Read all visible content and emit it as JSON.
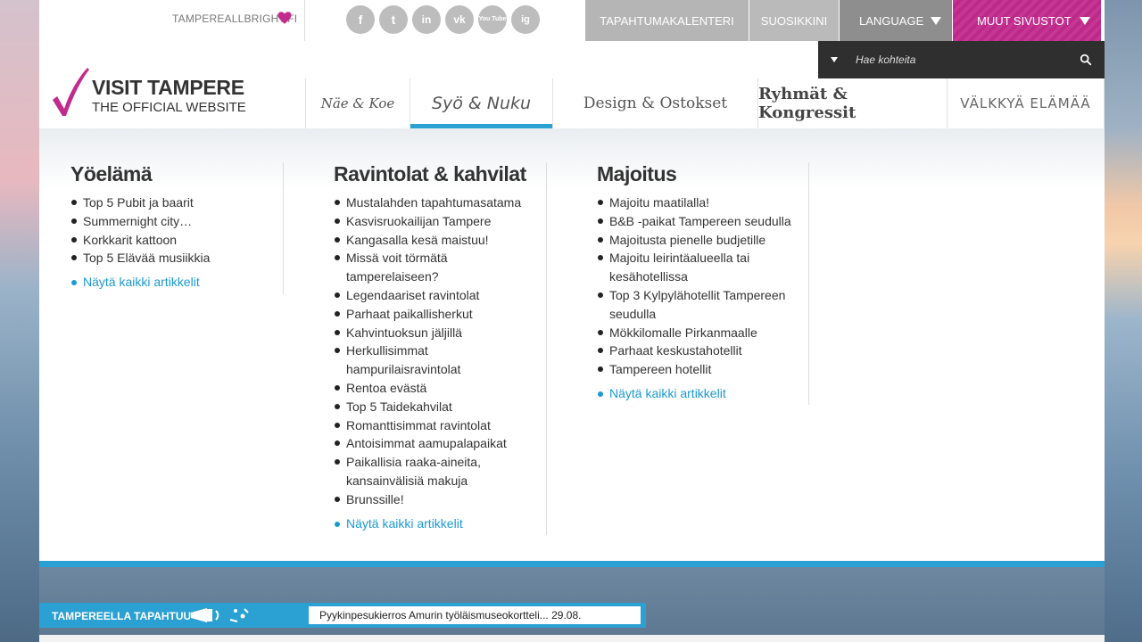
{
  "top": {
    "brand_link": "TAMPEREALLBRIGHT.FI",
    "social": [
      "f",
      "t",
      "in",
      "vk",
      "You Tube",
      "ig"
    ],
    "nav": {
      "calendar": "TAPAHTUMAKALENTERI",
      "favorites": "SUOSIKKINI",
      "language": "LANGUAGE",
      "other_sites": "MUUT SIVUSTOT"
    },
    "search": {
      "placeholder": "Hae kohteita"
    }
  },
  "logo": {
    "title": "VISIT TAMPERE",
    "subtitle": "THE OFFICIAL WEBSITE"
  },
  "main_nav": [
    "Näe & Koe",
    "Syö & Nuku",
    "Design & Ostokset",
    "Ryhmät & Kongressit",
    "VÄLKKYÄ ELÄMÄÄ"
  ],
  "mega": {
    "columns": [
      {
        "title": "Yöelämä",
        "items": [
          "Top 5 Pubit ja baarit",
          "Summernight city…",
          "Korkkarit kattoon",
          "Top 5 Elävää musiikkia"
        ],
        "more": "Näytä kaikki artikkelit"
      },
      {
        "title": "Ravintolat & kahvilat",
        "items": [
          "Mustalahden tapahtumasatama",
          "Kasvisruokailijan Tampere",
          "Kangasalla kesä maistuu!",
          "Missä voit törmätä tamperelaiseen?",
          "Legendaariset ravintolat",
          "Parhaat paikallisherkut",
          "Kahvintuoksun jäljillä",
          "Herkullisimmat hampurilaisravintolat",
          "Rentoa evästä",
          "Top 5 Taidekahvilat",
          "Romanttisimmat ravintolat",
          "Antoisimmat aamupalapaikat",
          "Paikallisia raaka-aineita, kansainvälisiä makuja",
          "Brunssille!"
        ],
        "more": "Näytä kaikki artikkelit"
      },
      {
        "title": "Majoitus",
        "items": [
          "Majoitu maatilalla!",
          "B&B -paikat Tampereen seudulla",
          "Majoitusta pienelle budjetille",
          "Majoitu leirintäalueella tai kesähotellissa",
          "Top 3 Kylpylähotellit Tampereen seudulla",
          "Mökkilomalle Pirkanmaalle",
          "Parhaat keskustahotellit",
          "Tampereen hotellit"
        ],
        "more": "Näytä kaikki artikkelit"
      }
    ]
  },
  "ticker": {
    "title": "TAMPEREELLA TAPAHTUU",
    "text": "Pyykinpesukierros Amurin työläismuseokortteli... 29.08."
  },
  "colors": {
    "accent_blue": "#2ba0d2",
    "accent_pink": "#c22a8d",
    "dark": "#2f2f2f"
  }
}
